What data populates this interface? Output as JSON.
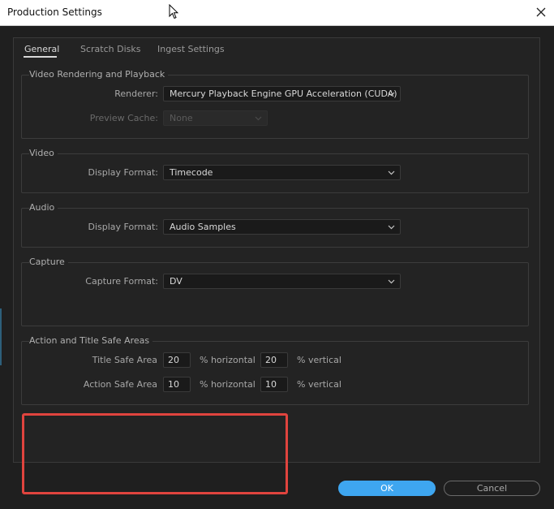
{
  "window": {
    "title": "Production Settings"
  },
  "tabs": [
    {
      "label": "General",
      "active": true
    },
    {
      "label": "Scratch Disks",
      "active": false
    },
    {
      "label": "Ingest Settings",
      "active": false
    }
  ],
  "video_rendering": {
    "title": "Video Rendering and Playback",
    "renderer_label": "Renderer:",
    "renderer_value": "Mercury Playback Engine GPU Acceleration (CUDA)",
    "preview_cache_label": "Preview Cache:",
    "preview_cache_value": "None"
  },
  "video": {
    "title": "Video",
    "display_format_label": "Display Format:",
    "display_format_value": "Timecode"
  },
  "audio": {
    "title": "Audio",
    "display_format_label": "Display Format:",
    "display_format_value": "Audio Samples"
  },
  "capture": {
    "title": "Capture",
    "capture_format_label": "Capture Format:",
    "capture_format_value": "DV"
  },
  "safe_areas": {
    "title": "Action and Title Safe Areas",
    "title_safe_label": "Title Safe Area",
    "title_safe_h": "20",
    "title_safe_v": "20",
    "action_safe_label": "Action Safe Area",
    "action_safe_h": "10",
    "action_safe_v": "10",
    "horizontal_unit": "% horizontal",
    "vertical_unit": "% vertical"
  },
  "buttons": {
    "ok": "OK",
    "cancel": "Cancel"
  },
  "colors": {
    "accent": "#3ea6f0",
    "highlight": "#e0443e",
    "background": "#232323"
  }
}
